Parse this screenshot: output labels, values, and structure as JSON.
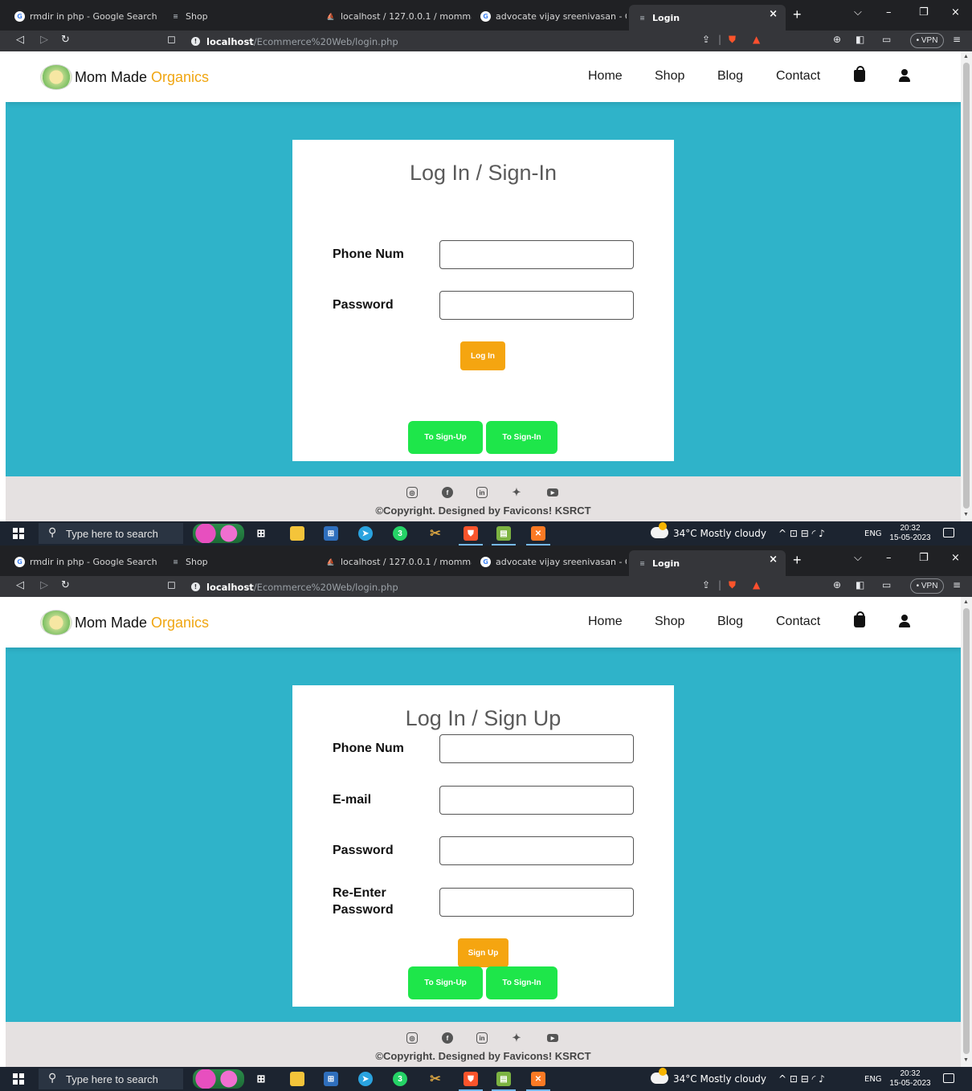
{
  "browser": {
    "tabs": [
      {
        "label": "rmdir in php - Google Search",
        "icon": "google-icon"
      },
      {
        "label": "Shop",
        "icon": "site-icon"
      },
      {
        "label": "localhost / 127.0.0.1 / mommadeo",
        "icon": "phpmyadmin-icon"
      },
      {
        "label": "advocate vijay sreenivasan - Goog",
        "icon": "google-icon"
      },
      {
        "label": "Login",
        "icon": "site-icon"
      }
    ],
    "tab_close": "×",
    "new_tab": "+",
    "window_controls": [
      "⌵",
      "–",
      "❐",
      "×"
    ],
    "url_host": "localhost",
    "url_path": "/Ecommerce%20Web/login.php",
    "vpn_label": "• VPN"
  },
  "site": {
    "brand_main": "Mom Made",
    "brand_accent": "Organics",
    "nav": [
      "Home",
      "Shop",
      "Blog",
      "Contact"
    ],
    "footer_copyright": "©Copyright. Designed by Favicons! KSRCT",
    "social_icons": [
      "instagram-icon",
      "facebook-icon",
      "linkedin-icon",
      "twitter-icon",
      "youtube-icon"
    ],
    "colors": {
      "background": "#2fb3c9",
      "accent": "#f0a612",
      "orange_button": "#f5a510",
      "green_button": "#1ee64a"
    }
  },
  "login_form": {
    "title": "Log In / Sign-In",
    "phone_label": "Phone Num",
    "password_label": "Password",
    "phone_value": "",
    "password_value": "",
    "submit_label": "Log In",
    "to_signup_label": "To Sign-Up",
    "to_signin_label": "To Sign-In"
  },
  "signup_form": {
    "title": "Log In / Sign Up",
    "phone_label": "Phone Num",
    "email_label": "E-mail",
    "password_label": "Password",
    "reenter_label_line1": "Re-Enter",
    "reenter_label_line2": "Password",
    "phone_value": "",
    "email_value": "",
    "password_value": "",
    "reenter_value": "",
    "submit_label": "Sign Up",
    "to_signup_label": "To Sign-Up",
    "to_signin_label": "To Sign-In"
  },
  "taskbar": {
    "search_placeholder": "Type here to search",
    "weather": "34°C  Mostly cloudy",
    "language": "ENG",
    "time": "20:32",
    "date": "15-05-2023",
    "whatsapp_badge": "3",
    "notification_count": "3"
  }
}
